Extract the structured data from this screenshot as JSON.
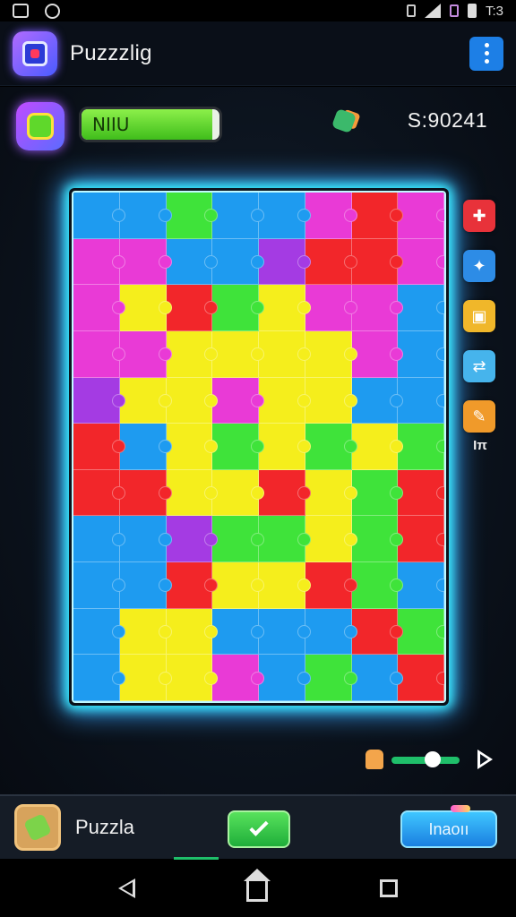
{
  "app": {
    "title": "Puzzzlig"
  },
  "status_bar": {
    "time": "T:3"
  },
  "hud": {
    "level_label": "NIIU",
    "level_fill_fraction": 0.95,
    "score": "S:90241"
  },
  "board": {
    "columns": 8,
    "rows": 11,
    "colors": {
      "B": "#1e9bf0",
      "M": "#e93ad6",
      "R": "#f2262a",
      "Y": "#f5ee1c",
      "G": "#3fe33a",
      "P": "#a43be3",
      "C": "#19c8e6",
      "O": "#f5a01c"
    },
    "grid": [
      "BBGBBMRM",
      "MMBBPRRM",
      "MYRGYMMB",
      "MMYYYYMB",
      "PYYMYYBB",
      "RBYGYGYG",
      "RRYYRYGR",
      "BBPGGYGR",
      "BBRYYRGB",
      "BYYBBBRG",
      "BYYMBGBR"
    ]
  },
  "side_tools": {
    "items": [
      {
        "name": "hint-tool",
        "color": "#e8323a",
        "glyph": "✚"
      },
      {
        "name": "magic-tool",
        "color": "#2d8ce6",
        "glyph": "✦"
      },
      {
        "name": "box-tool",
        "color": "#f0b72a",
        "glyph": "▣"
      },
      {
        "name": "shuffle-tool",
        "color": "#46b4ec",
        "glyph": "⇄"
      },
      {
        "name": "edit-tool",
        "color": "#f09a2a",
        "glyph": "✎"
      }
    ],
    "label": "Iπ"
  },
  "zoom": {
    "level_fraction": 0.6
  },
  "bottom_bar": {
    "title": "Puzzla",
    "action_label": "Inaoıı"
  }
}
